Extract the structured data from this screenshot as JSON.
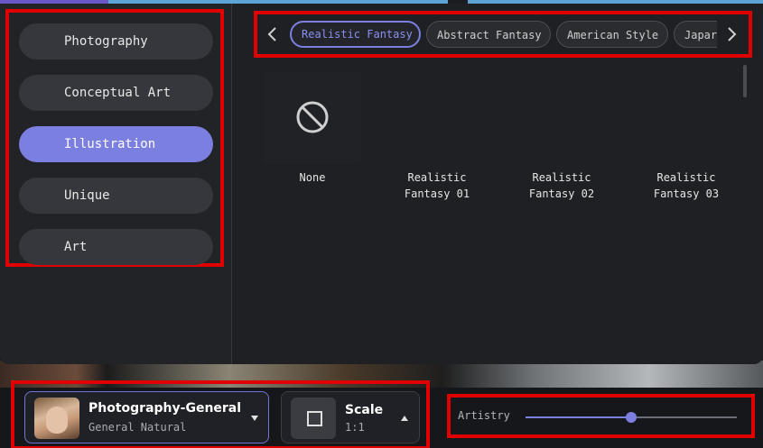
{
  "colors": {
    "accent": "#7b80e0",
    "highlight_box": "#e00000"
  },
  "categories": [
    {
      "label": "Photography",
      "active": false
    },
    {
      "label": "Conceptual Art",
      "active": false
    },
    {
      "label": "Illustration",
      "active": true
    },
    {
      "label": "Unique",
      "active": false
    },
    {
      "label": "Art",
      "active": false
    }
  ],
  "style_tabs": [
    {
      "label": "Realistic Fantasy",
      "active": true
    },
    {
      "label": "Abstract Fantasy",
      "active": false
    },
    {
      "label": "American Style",
      "active": false
    },
    {
      "label": "Japar",
      "active": false
    }
  ],
  "style_tiles": [
    {
      "label": "None",
      "icon": "none-icon"
    },
    {
      "label": "Realistic\nFantasy 01"
    },
    {
      "label": "Realistic\nFantasy 02"
    },
    {
      "label": "Realistic\nFantasy 03"
    }
  ],
  "model": {
    "title": "Photography-General",
    "subtitle": "General Natural"
  },
  "scale": {
    "title": "Scale",
    "value": "1:1"
  },
  "artistry": {
    "label": "Artistry",
    "value": 0.5
  }
}
